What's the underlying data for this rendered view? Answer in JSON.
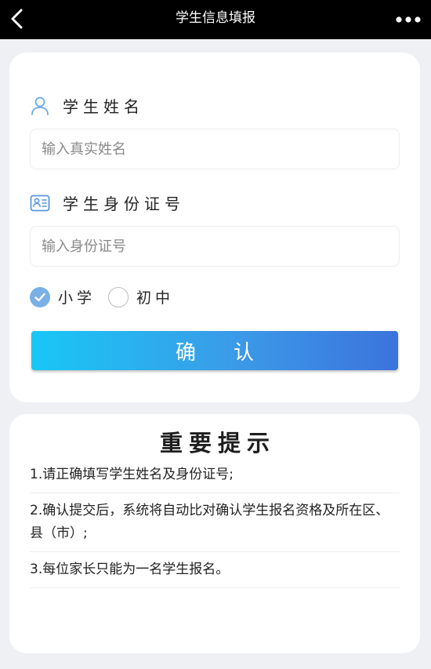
{
  "navbar": {
    "title": "学生信息填报",
    "back_icon": "chevron-left-icon",
    "more_icon": "more-dots-icon"
  },
  "form": {
    "name_label": "学生姓名",
    "name_icon": "person-icon",
    "name_placeholder": "输入真实姓名",
    "name_value": "",
    "id_label": "学生身份证号",
    "id_icon": "id-card-icon",
    "id_placeholder": "输入身份证号",
    "id_value": "",
    "school_level": {
      "options": [
        "小学",
        "初中"
      ],
      "selected": "小学"
    },
    "confirm_label": "确认"
  },
  "notice": {
    "title": "重要提示",
    "items": [
      "1.请正确填写学生姓名及身份证号;",
      "2.确认提交后，系统将自动比对确认学生报名资格及所在区、县（市）;",
      "3.每位家长只能为一名学生报名。"
    ]
  },
  "colors": {
    "navbar_bg": "#000000",
    "page_bg": "#eef0f4",
    "radio_checked": "#7ab0e6",
    "button_gradient_start": "#18c7f6",
    "button_gradient_end": "#3b73dc"
  }
}
